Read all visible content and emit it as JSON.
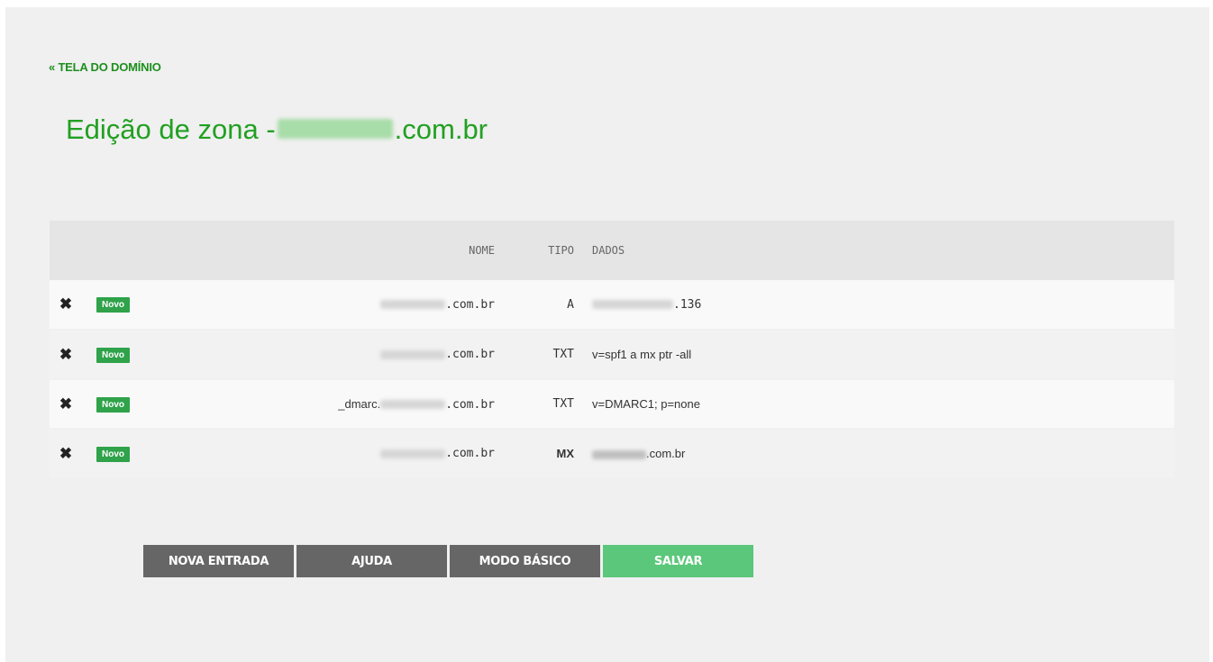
{
  "nav": {
    "back_label": "« TELA DO DOMÍNIO"
  },
  "title": {
    "prefix": "Edição de zona - ",
    "suffix": ".com.br"
  },
  "table": {
    "headers": {
      "nome": "NOME",
      "tipo": "TIPO",
      "dados": "DADOS"
    },
    "rows": [
      {
        "delete": "✖",
        "badge": "Novo",
        "name_prefix": "",
        "name_suffix": ".com.br",
        "type": "A",
        "data_suffix": ".136"
      },
      {
        "delete": "✖",
        "badge": "Novo",
        "name_prefix": "",
        "name_suffix": ".com.br",
        "type": "TXT",
        "data": "v=spf1 a mx ptr -all"
      },
      {
        "delete": "✖",
        "badge": "Novo",
        "name_prefix": "_dmarc.",
        "name_suffix": ".com.br",
        "type": "TXT",
        "data": "v=DMARC1; p=none"
      },
      {
        "delete": "✖",
        "badge": "Novo",
        "name_prefix": "",
        "name_suffix": ".com.br",
        "type": "MX",
        "data_suffix": ".com.br"
      }
    ]
  },
  "buttons": {
    "new_entry": "NOVA ENTRADA",
    "help": "AJUDA",
    "basic_mode": "MODO BÁSICO",
    "save": "SALVAR"
  },
  "colors": {
    "title_green": "#22a022",
    "badge_green": "#2fa24a",
    "save_green": "#5bc77a",
    "button_gray": "#666666"
  }
}
